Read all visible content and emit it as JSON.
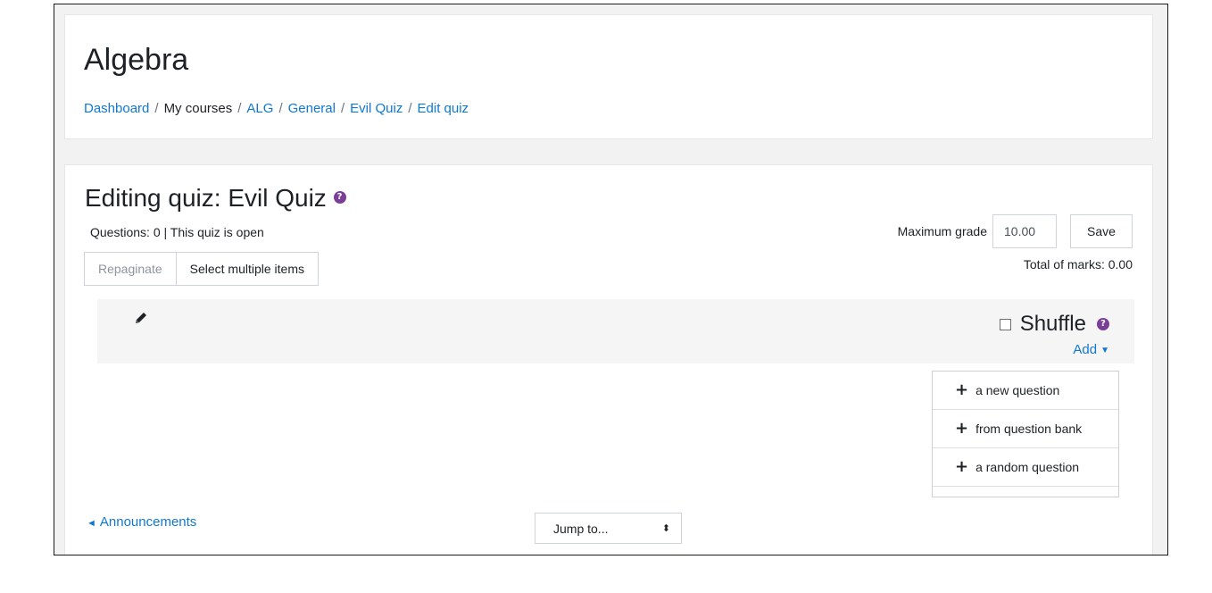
{
  "header": {
    "course_title": "Algebra",
    "breadcrumb": [
      "Dashboard",
      "My courses",
      "ALG",
      "General",
      "Evil Quiz",
      "Edit quiz"
    ]
  },
  "main": {
    "title": "Editing quiz: Evil Quiz",
    "info": "Questions: 0 | This quiz is open",
    "repaginate_label": "Repaginate",
    "select_multiple_label": "Select multiple items",
    "max_grade_label": "Maximum grade",
    "max_grade_value": "10.00",
    "save_label": "Save",
    "total_marks": "Total of marks: 0.00"
  },
  "section": {
    "shuffle_label": "Shuffle",
    "shuffle_checked": false,
    "add_label": "Add"
  },
  "add_menu": {
    "items": [
      {
        "label": "a new question"
      },
      {
        "label": "from question bank"
      },
      {
        "label": "a random question"
      }
    ]
  },
  "footer": {
    "prev_activity": "Announcements",
    "jump_to": "Jump to..."
  },
  "colors": {
    "link": "#1177d1",
    "help_icon": "#7a3e96",
    "section_bg": "#f5f5f5"
  }
}
